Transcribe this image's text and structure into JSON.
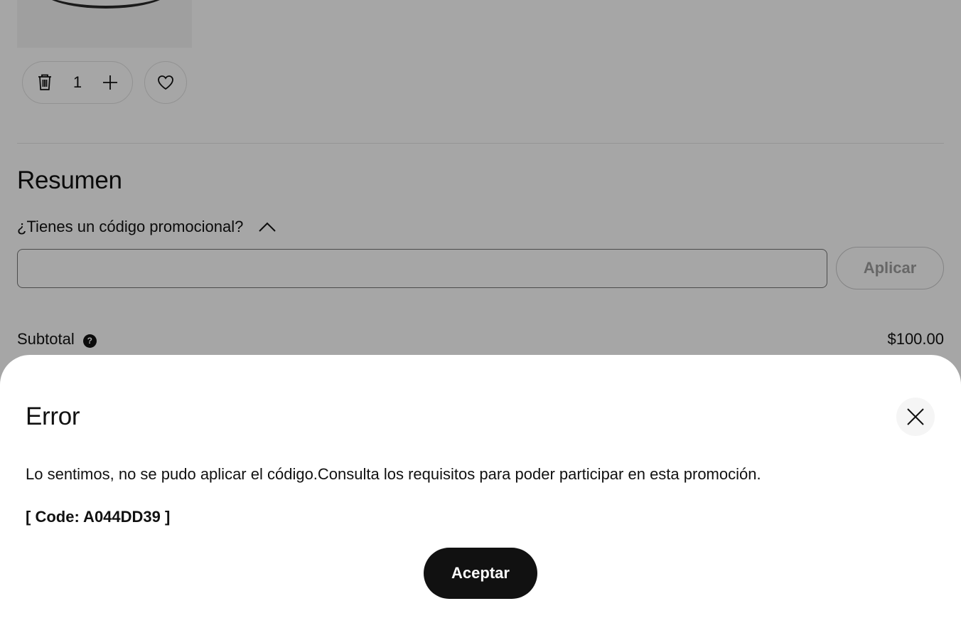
{
  "cart": {
    "quantity": "1",
    "icons": {
      "delete": "trash-icon",
      "increment": "plus-icon",
      "favorite": "heart-icon"
    }
  },
  "summary": {
    "title": "Resumen",
    "promo_toggle_label": "¿Tienes un código promocional?",
    "promo_toggle_icon": "chevron-up-icon",
    "promo_input_value": "",
    "apply_label": "Aplicar",
    "subtotal_label": "Subtotal",
    "subtotal_help_icon": "question-icon",
    "subtotal_value": "$100.00"
  },
  "dialog": {
    "title": "Error",
    "close_icon": "close-icon",
    "message": "Lo sentimos, no se pudo aplicar el código.Consulta los requisitos para poder participar en esta promoción.",
    "code": "[ Code: A044DD39 ]",
    "accept_label": "Aceptar"
  },
  "colors": {
    "overlay": "#000000",
    "primary_button": "#111111",
    "close_button_bg": "#f5f5f5"
  }
}
